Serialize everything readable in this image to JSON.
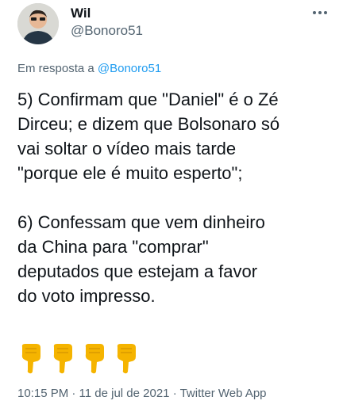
{
  "author": {
    "name": "Wil",
    "handle": "@Bonoro51"
  },
  "reply": {
    "prefix": "Em resposta a ",
    "mention": "@Bonoro51"
  },
  "body": {
    "p1_l1": "5) Confirmam que \"Daniel\" é o Zé",
    "p1_l2": "Dirceu; e dizem que Bolsonaro só",
    "p1_l3": "vai soltar o vídeo mais tarde",
    "p1_l4": "\"porque ele é muito esperto\";",
    "p2_l1": "6) Confessam que vem dinheiro",
    "p2_l2": "da China para \"comprar\"",
    "p2_l3": "deputados que estejam a favor",
    "p2_l4": "do voto impresso."
  },
  "emojis": [
    "pointing-down-hand-icon",
    "pointing-down-hand-icon",
    "pointing-down-hand-icon",
    "pointing-down-hand-icon"
  ],
  "meta": {
    "text": "10:15 PM · 11 de jul de 2021 · Twitter Web App"
  },
  "colors": {
    "text": "#0f1419",
    "secondary": "#536471",
    "accent": "#1d9bf0",
    "emoji": "#f5b400"
  }
}
